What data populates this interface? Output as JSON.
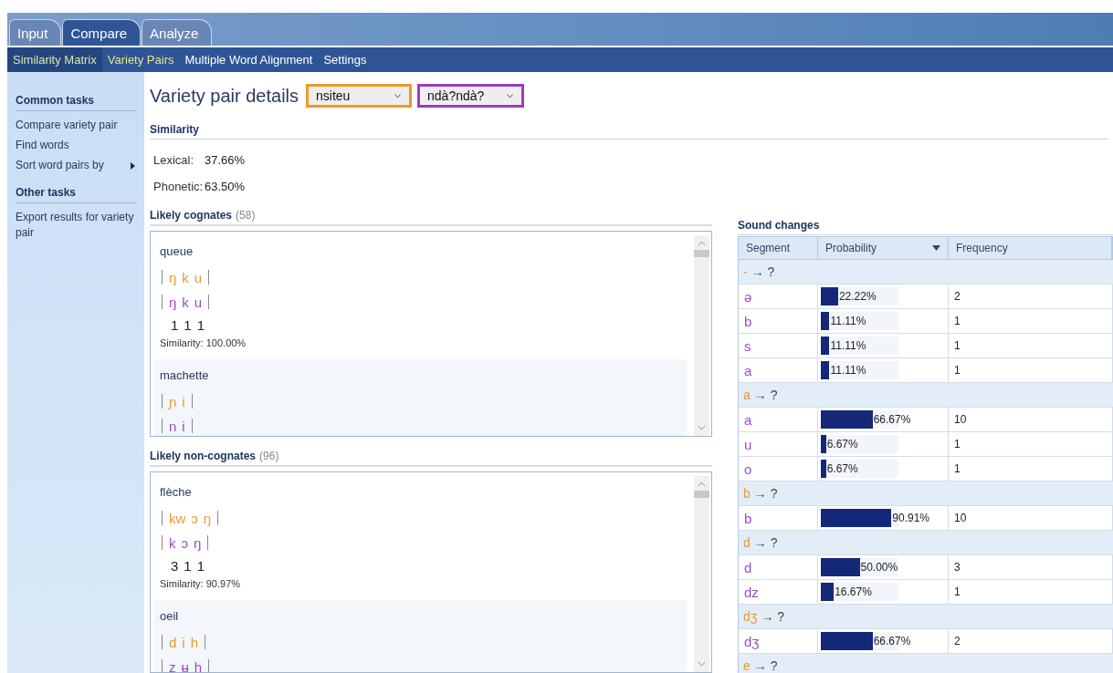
{
  "tabs": [
    {
      "label": "Input",
      "selected": false
    },
    {
      "label": "Compare",
      "selected": true
    },
    {
      "label": "Analyze",
      "selected": false
    }
  ],
  "subnav": [
    {
      "label": "Similarity Matrix",
      "selected": false,
      "hovered": true
    },
    {
      "label": "Variety Pairs",
      "selected": true,
      "hovered": false
    },
    {
      "label": "Multiple Word Alignment",
      "selected": false,
      "hovered": false
    },
    {
      "label": "Settings",
      "selected": false,
      "hovered": false
    }
  ],
  "sidebar": {
    "sections": [
      {
        "title": "Common tasks",
        "items": [
          {
            "label": "Compare variety pair",
            "submenu": false
          },
          {
            "label": "Find words",
            "submenu": false
          },
          {
            "label": "Sort word pairs by",
            "submenu": true
          }
        ]
      },
      {
        "title": "Other tasks",
        "items": [
          {
            "label": "Export results for variety pair",
            "submenu": false
          }
        ]
      }
    ]
  },
  "header": {
    "title": "Variety pair details",
    "variety_1": "nsiteu",
    "variety_2": "ndà?ndà?"
  },
  "similarity": {
    "title": "Similarity",
    "rows": [
      {
        "label": "Lexical:",
        "value": "37.66%"
      },
      {
        "label": "Phonetic:",
        "value": "63.50%"
      }
    ]
  },
  "word_lists": [
    {
      "title": "Likely cognates",
      "count": "(58)",
      "entries": [
        {
          "word": "queue",
          "top": [
            "ŋ",
            "k",
            "u"
          ],
          "bottom": [
            "ŋ",
            "k",
            "u"
          ],
          "scores": [
            "1",
            "1",
            "1"
          ],
          "similarity": "Similarity: 100.00%"
        },
        {
          "word": "machette",
          "top": [
            "ɲ",
            "i"
          ],
          "bottom": [
            "n",
            "i"
          ]
        }
      ]
    },
    {
      "title": "Likely non-cognates",
      "count": "(96)",
      "entries": [
        {
          "word": "flèche",
          "top": [
            "kw",
            "ɔ",
            "ŋ"
          ],
          "bottom": [
            "k",
            "ɔ",
            "ŋ"
          ],
          "scores": [
            "3",
            "1",
            "1"
          ],
          "similarity": "Similarity: 90.97%"
        },
        {
          "word": "oeil",
          "top": [
            "d",
            "i",
            "h"
          ],
          "bottom": [
            "z",
            "ʉ",
            "h"
          ]
        }
      ]
    }
  ],
  "sound_changes": {
    "title": "Sound changes",
    "columns": [
      {
        "label": "Segment",
        "sorted": false
      },
      {
        "label": "Probability",
        "sorted": true
      },
      {
        "label": "Frequency",
        "sorted": false
      }
    ],
    "groups": [
      {
        "source": "-",
        "rest": "→ ?",
        "rows": [
          {
            "segment": "ə",
            "level": 0.2222,
            "probability": "22.22%",
            "frequency": "2"
          },
          {
            "segment": "b",
            "level": 0.1111,
            "probability": "11.11%",
            "frequency": "1"
          },
          {
            "segment": "s",
            "level": 0.1111,
            "probability": "11.11%",
            "frequency": "1"
          },
          {
            "segment": "a",
            "level": 0.1111,
            "probability": "11.11%",
            "frequency": "1"
          }
        ]
      },
      {
        "source": "a",
        "rest": "→ ?",
        "rows": [
          {
            "segment": "a",
            "level": 0.6667,
            "probability": "66.67%",
            "frequency": "10"
          },
          {
            "segment": "u",
            "level": 0.0667,
            "probability": "6.67%",
            "frequency": "1"
          },
          {
            "segment": "o",
            "level": 0.0667,
            "probability": "6.67%",
            "frequency": "1"
          }
        ]
      },
      {
        "source": "b",
        "rest": "→ ?",
        "rows": [
          {
            "segment": "b",
            "level": 0.9091,
            "probability": "90.91%",
            "frequency": "10"
          }
        ]
      },
      {
        "source": "d",
        "rest": "→ ?",
        "rows": [
          {
            "segment": "d",
            "level": 0.5,
            "probability": "50.00%",
            "frequency": "3"
          },
          {
            "segment": "dz",
            "level": 0.1667,
            "probability": "16.67%",
            "frequency": "1"
          }
        ]
      },
      {
        "source": "dʒ",
        "rest": "→ ?",
        "rows": [
          {
            "segment": "dʒ",
            "level": 0.6667,
            "probability": "66.67%",
            "frequency": "2"
          }
        ]
      },
      {
        "source": "e",
        "rest": "→ ?"
      }
    ]
  }
}
